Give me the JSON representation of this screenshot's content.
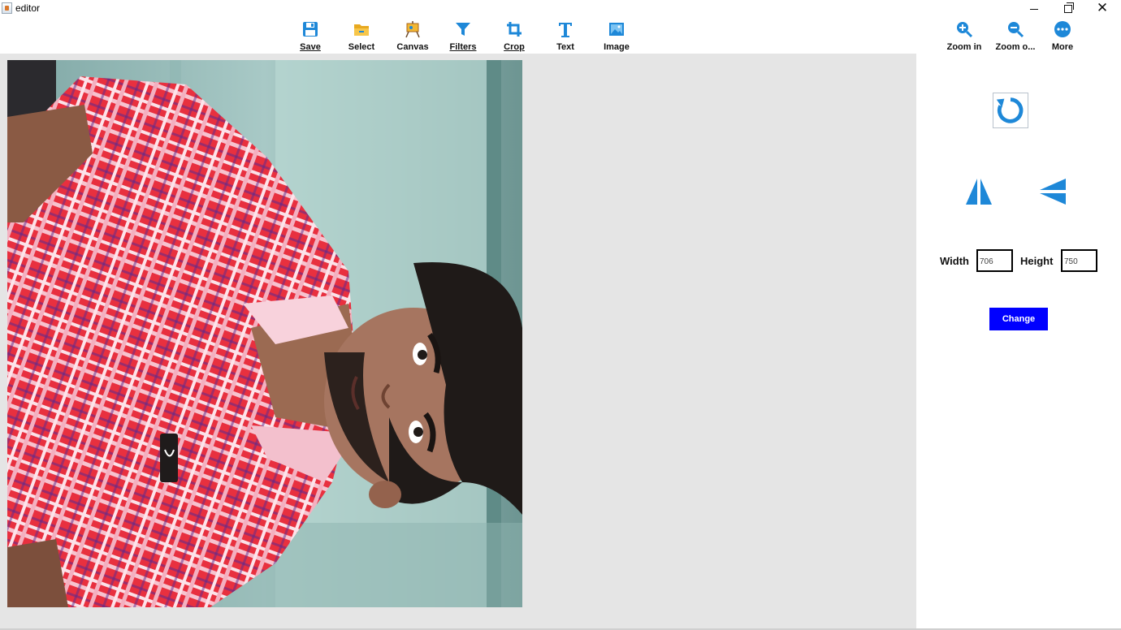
{
  "window": {
    "title": "editor",
    "icon": "java-cup-icon"
  },
  "toolbar": {
    "tools": [
      {
        "label": "Save",
        "mnemonic": "S",
        "icon": "save-icon"
      },
      {
        "label": "Select",
        "icon": "folder-open-icon"
      },
      {
        "label": "Canvas",
        "icon": "easel-icon"
      },
      {
        "label": "Filters",
        "mnemonic": "F",
        "icon": "filter-icon"
      },
      {
        "label": "Crop",
        "mnemonic": "C",
        "icon": "crop-icon"
      },
      {
        "label": "Text",
        "icon": "text-icon"
      },
      {
        "label": "Image",
        "icon": "image-icon"
      }
    ],
    "right_tools": [
      {
        "label": "Zoom in",
        "icon": "zoom-in-icon"
      },
      {
        "label": "Zoom o...",
        "icon": "zoom-out-icon"
      },
      {
        "label": "More",
        "icon": "more-icon"
      }
    ]
  },
  "panel": {
    "width_label": "Width",
    "width_value": "706",
    "height_label": "Height",
    "height_value": "750",
    "change_label": "Change"
  },
  "colors": {
    "accent": "#1e88d8",
    "button": "#0000ff",
    "canvas_bg": "#e5e5e5"
  }
}
